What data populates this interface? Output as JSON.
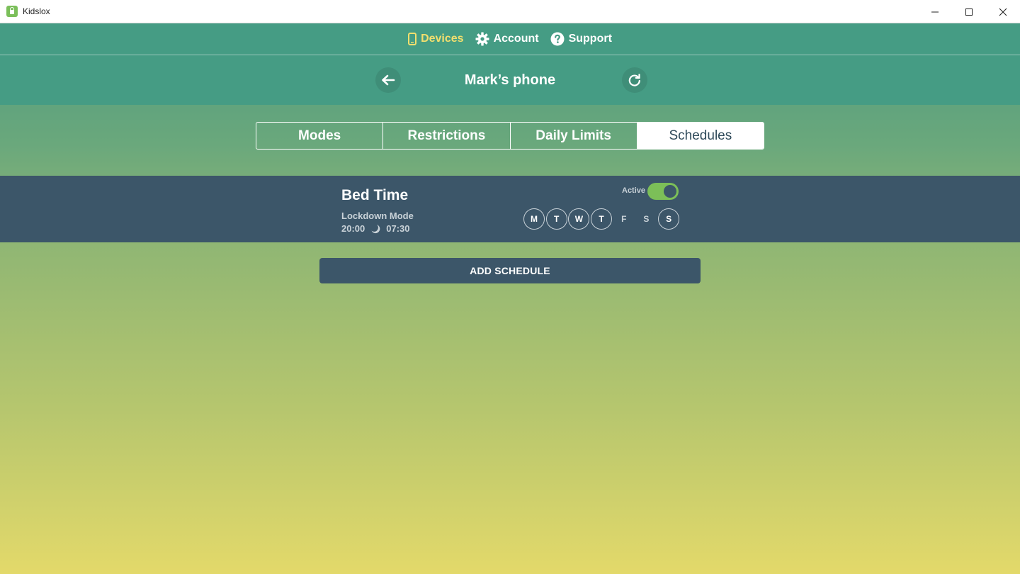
{
  "window": {
    "title": "Kidslox",
    "controls": [
      "minimize-icon",
      "maximize-icon",
      "close-icon"
    ]
  },
  "nav": {
    "items": [
      {
        "label": "Devices",
        "icon": "phone-icon",
        "active": true
      },
      {
        "label": "Account",
        "icon": "gear-icon",
        "active": false
      },
      {
        "label": "Support",
        "icon": "help-icon",
        "active": false
      }
    ]
  },
  "device": {
    "name": "Mark’s phone",
    "back_icon": "arrow-left-icon",
    "refresh_icon": "refresh-icon"
  },
  "tabs": [
    {
      "label": "Modes",
      "active": false
    },
    {
      "label": "Restrictions",
      "active": false
    },
    {
      "label": "Daily Limits",
      "active": false
    },
    {
      "label": "Schedules",
      "active": true
    }
  ],
  "schedule": {
    "name": "Bed Time",
    "mode": "Lockdown Mode",
    "start": "20:00",
    "end": "07:30",
    "active_label": "Active",
    "active": true,
    "days": [
      {
        "label": "M",
        "selected": true
      },
      {
        "label": "T",
        "selected": true
      },
      {
        "label": "W",
        "selected": true
      },
      {
        "label": "T",
        "selected": true
      },
      {
        "label": "F",
        "selected": false
      },
      {
        "label": "S",
        "selected": false
      },
      {
        "label": "S",
        "selected": true
      }
    ]
  },
  "actions": {
    "add_schedule": "ADD SCHEDULE"
  },
  "colors": {
    "header": "#459c84",
    "active_nav": "#f2df6e",
    "row_bg": "#3c5669",
    "toggle_on": "#7cbf58",
    "gradient_bottom": "#e3d96a"
  }
}
